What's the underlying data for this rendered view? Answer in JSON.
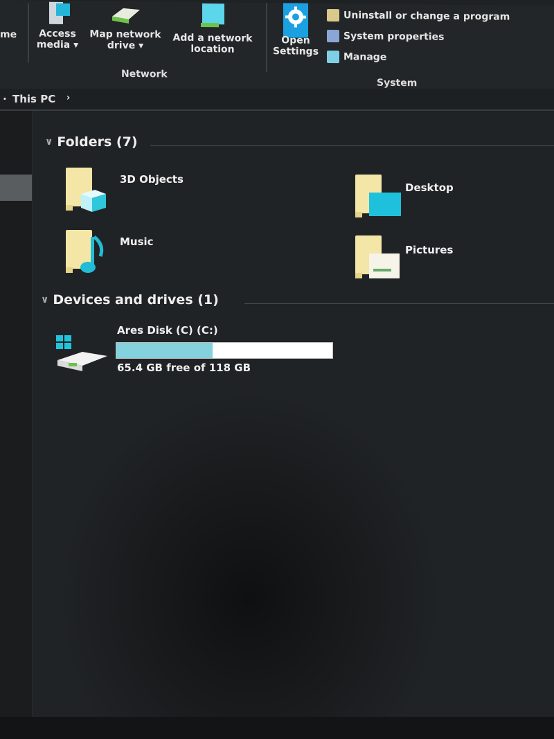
{
  "ribbon": {
    "partial_left_label": "me",
    "network_group": {
      "label": "Network",
      "items": [
        {
          "label_line1": "Access",
          "label_line2": "media ▾",
          "icon": "media-server-icon"
        },
        {
          "label_line1": "Map network",
          "label_line2": "drive ▾",
          "icon": "map-drive-icon"
        },
        {
          "label_line1": "Add a network",
          "label_line2": "location",
          "icon": "network-location-icon"
        }
      ]
    },
    "system_group": {
      "label": "System",
      "open_settings": {
        "label_line1": "Open",
        "label_line2": "Settings",
        "icon": "gear-icon"
      },
      "links": [
        {
          "label": "Uninstall or change a program",
          "icon": "uninstall-icon"
        },
        {
          "label": "System properties",
          "icon": "system-properties-icon"
        },
        {
          "label": "Manage",
          "icon": "manage-icon"
        }
      ]
    }
  },
  "address_bar": {
    "crumbs": [
      "This PC"
    ],
    "separator": "›"
  },
  "folders_section": {
    "title": "Folders (7)",
    "items": [
      {
        "name": "3D Objects",
        "icon": "3d-objects-folder-icon"
      },
      {
        "name": "Desktop",
        "icon": "desktop-folder-icon"
      },
      {
        "name": "Music",
        "icon": "music-folder-icon"
      },
      {
        "name": "Pictures",
        "icon": "pictures-folder-icon"
      }
    ]
  },
  "devices_section": {
    "title": "Devices and drives (1)",
    "drives": [
      {
        "name": "Ares Disk (C) (C:)",
        "free_text": "65.4 GB free of 118 GB",
        "free_gb": 65.4,
        "total_gb": 118,
        "used_fraction": 0.446,
        "icon": "windows-drive-icon"
      }
    ]
  },
  "colors": {
    "accent": "#1ba1e2",
    "drive_fill": "#83d2de",
    "folder": "#f3e6a6"
  }
}
